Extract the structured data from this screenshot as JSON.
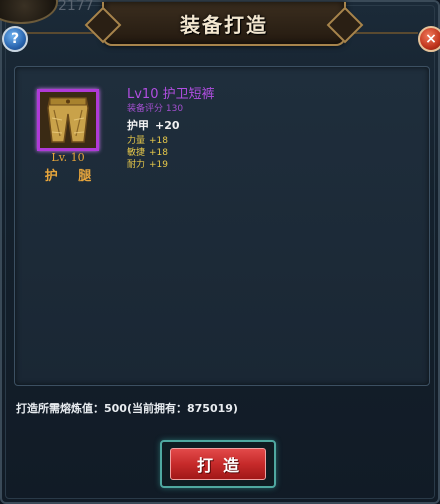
{
  "window": {
    "title": "装备打造",
    "top_left_partial": "2177"
  },
  "buttons": {
    "help": "?",
    "close": "×",
    "forge": "打造"
  },
  "item": {
    "level_label": "Lv. 10",
    "type_label": "护 腿",
    "name": "Lv10 护卫短裤",
    "score_label": "装备评分",
    "score_value": "130",
    "armor": {
      "label": "护甲",
      "value": "+20"
    },
    "attributes": [
      {
        "label": "力量",
        "value": "+18"
      },
      {
        "label": "敏捷",
        "value": "+18"
      },
      {
        "label": "耐力",
        "value": "+19"
      }
    ],
    "icon": "leather-leggings-icon",
    "rarity_color": "#b03ad8"
  },
  "cost": {
    "text": "打造所需熔炼值：500(当前拥有：875019)"
  },
  "colors": {
    "title": "#f2e6cf",
    "item_name": "#b04ee0",
    "attribute": "#e8c94a",
    "level": "#e6a53c",
    "forge_button": "#c62a2a"
  }
}
